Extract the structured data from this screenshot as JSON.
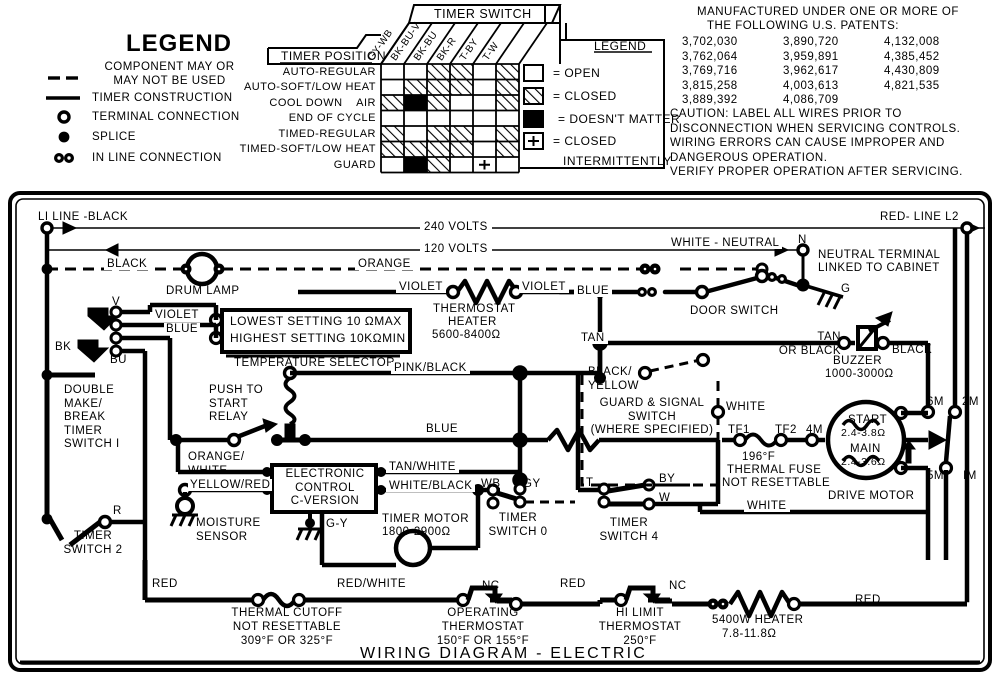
{
  "legend": {
    "title": "LEGEND",
    "items": [
      {
        "symbol": "dashed-line",
        "label": "COMPONENT MAY OR\nMAY NOT BE USED"
      },
      {
        "symbol": "solid-line",
        "label": "TIMER CONSTRUCTION"
      },
      {
        "symbol": "open-circle",
        "label": "TERMINAL CONNECTION"
      },
      {
        "symbol": "filled-circle",
        "label": "SPLICE"
      },
      {
        "symbol": "double-circle",
        "label": "IN LINE CONNECTION"
      }
    ]
  },
  "timer_table": {
    "title": "TIMER SWITCH",
    "position_header": "TIMER POSITION",
    "columns": [
      "GY-WB",
      "BK-BU-V",
      "BK-BU",
      "BK-R",
      "T-BY",
      "T-W"
    ],
    "rows": [
      {
        "label": "AUTO-REGULAR",
        "cells": [
          "open",
          "open",
          "closed",
          "closed",
          "open",
          "closed"
        ]
      },
      {
        "label": "AUTO-SOFT/LOW HEAT",
        "cells": [
          "open",
          "closed",
          "closed",
          "closed",
          "open",
          "closed"
        ]
      },
      {
        "label": "COOL DOWN    AIR",
        "cells": [
          "closed",
          "black",
          "closed",
          "open",
          "open",
          "closed"
        ]
      },
      {
        "label": "END OF CYCLE",
        "cells": [
          "open",
          "open",
          "open",
          "open",
          "open",
          "open"
        ]
      },
      {
        "label": "TIMED-REGULAR",
        "cells": [
          "closed",
          "open",
          "closed",
          "closed",
          "open",
          "closed"
        ]
      },
      {
        "label": "TIMED-SOFT/LOW HEAT",
        "cells": [
          "closed",
          "closed",
          "closed",
          "closed",
          "open",
          "closed"
        ]
      },
      {
        "label": "GUARD",
        "cells": [
          "open",
          "black",
          "closed",
          "open",
          "plus",
          "open"
        ]
      }
    ],
    "legend_title": "LEGEND",
    "legend_items": [
      {
        "symbol": "open",
        "label": "= OPEN"
      },
      {
        "symbol": "closed",
        "label": "= CLOSED"
      },
      {
        "symbol": "black",
        "label": "= DOESN'T MATTER"
      },
      {
        "symbol": "plus",
        "label": "= CLOSED"
      }
    ],
    "legend_extra": "INTERMITTENTLY"
  },
  "patents": {
    "heading_line1": "MANUFACTURED UNDER ONE OR MORE OF",
    "heading_line2": "THE FOLLOWING U.S. PATENTS:",
    "col1": [
      "3,702,030",
      "3,762,064",
      "3,769,716",
      "3,815,258",
      "3,889,392"
    ],
    "col2": [
      "3,890,720",
      "3,959,891",
      "3,962,617",
      "4,003,613",
      "4,086,709"
    ],
    "col3": [
      "4,132,008",
      "4,385,452",
      "4,430,809",
      "4,821,535"
    ]
  },
  "caution": {
    "lines": [
      "CAUTION: LABEL ALL WIRES PRIOR TO",
      "DISCONNECTION WHEN SERVICING CONTROLS.",
      "WIRING ERRORS CAN CAUSE IMPROPER AND",
      "DANGEROUS OPERATION.",
      "VERIFY PROPER OPERATION AFTER SERVICING."
    ]
  },
  "diagram": {
    "title": "WIRING DIAGRAM - ELECTRIC",
    "line_l1": "LI LINE -BLACK",
    "line_l2": "RED- LINE L2",
    "volts_240": "240 VOLTS",
    "volts_120": "120 VOLTS",
    "white_neutral": "WHITE - NEUTRAL",
    "neutral_n": "N",
    "neutral_terminal_1": "NEUTRAL TERMINAL",
    "neutral_terminal_2": "LINKED TO CABINET",
    "ground_g": "G",
    "black": "BLACK",
    "orange": "ORANGE",
    "drum_lamp": "DRUM LAMP",
    "violet_left": "VIOLET",
    "violet_mid": "VIOLET",
    "violet_right": "VIOLET",
    "blue_ts": "BLUE",
    "blue_main": "BLUE",
    "blue_door": "BLUE",
    "term_v": "V",
    "term_bk": "BK",
    "term_bu": "BU",
    "temp_sel_line1": "LOWEST SETTING 10 ΩMAX",
    "temp_sel_line2": "HIGHEST SETTING 10KΩMIN",
    "temp_sel_label": "TEMPERATURE SELECTOR",
    "thermostat_heater_1": "THERMOSTAT",
    "thermostat_heater_2": "HEATER",
    "thermostat_heater_3": "5600-8400Ω",
    "door_switch": "DOOR SWITCH",
    "double_make_break": "DOUBLE\nMAKE/\nBREAK\nTIMER\nSWITCH I",
    "push_to_start": "PUSH TO\nSTART\nRELAY",
    "orange_white": "ORANGE/\nWHITE",
    "yellow_red": "YELLOW/RED",
    "electronic_control": "ELECTRONIC\nCONTROL\nC-VERSION",
    "moisture_sensor": "MOISTURE\nSENSOR",
    "gy_ground": "G-Y",
    "timer_motor_1": "TIMER MOTOR",
    "timer_motor_2": "1800-2900Ω",
    "pink_black": "PINK/BLACK",
    "tan_white": "TAN/WHITE",
    "white_black": "WHITE/BLACK",
    "wb": "WB",
    "gy": "GY",
    "timer_switch_0": "TIMER\nSWITCH 0",
    "timer_switch_2": "TIMER\nSWITCH 2",
    "timer_switch_4": "TIMER\nSWITCH 4",
    "term_r": "R",
    "term_t": "T",
    "term_by": "BY",
    "term_w": "W",
    "tan": "TAN",
    "black_yellow": "BLACK/\nYELLOW",
    "guard_signal": "GUARD & SIGNAL\nSWITCH\n(WHERE SPECIFIED)",
    "white_tf": "WHITE",
    "tf1": "TF1",
    "tf2": "TF2",
    "term_4m": "4M",
    "thermal_fuse_1": "196°F",
    "thermal_fuse_2": "THERMAL FUSE",
    "thermal_fuse_3": "NOT RESETTABLE",
    "white_motor": "WHITE",
    "tan_or_black": "TAN\nOR BLACK",
    "black_buzz": "BLACK",
    "buzzer_1": "BUZZER",
    "buzzer_2": "1000-3000Ω",
    "motor_start_1": "START",
    "motor_start_2": "2.4-3.8Ω",
    "motor_main_1": "MAIN",
    "motor_main_2": "2.4-3.6Ω",
    "drive_motor": "DRIVE MOTOR",
    "term_6m": "6M",
    "term_2m": "2M",
    "term_5m": "5M",
    "term_1m": "IM",
    "red_left": "RED",
    "red_white": "RED/WHITE",
    "red_mid": "RED",
    "red_right": "RED",
    "nc1": "NC",
    "nc2": "NC",
    "thermal_cutoff": "THERMAL CUTOFF\nNOT RESETTABLE\n309°F OR 325°F",
    "operating_thermostat": "OPERATING\nTHERMOSTAT\n150°F OR 155°F",
    "hi_limit": "HI LIMIT\nTHERMOSTAT\n250°F",
    "heater_1": "5400W HEATER",
    "heater_2": "7.8-11.8Ω"
  },
  "colors": {
    "ink": "#000000",
    "paper": "#ffffff"
  }
}
